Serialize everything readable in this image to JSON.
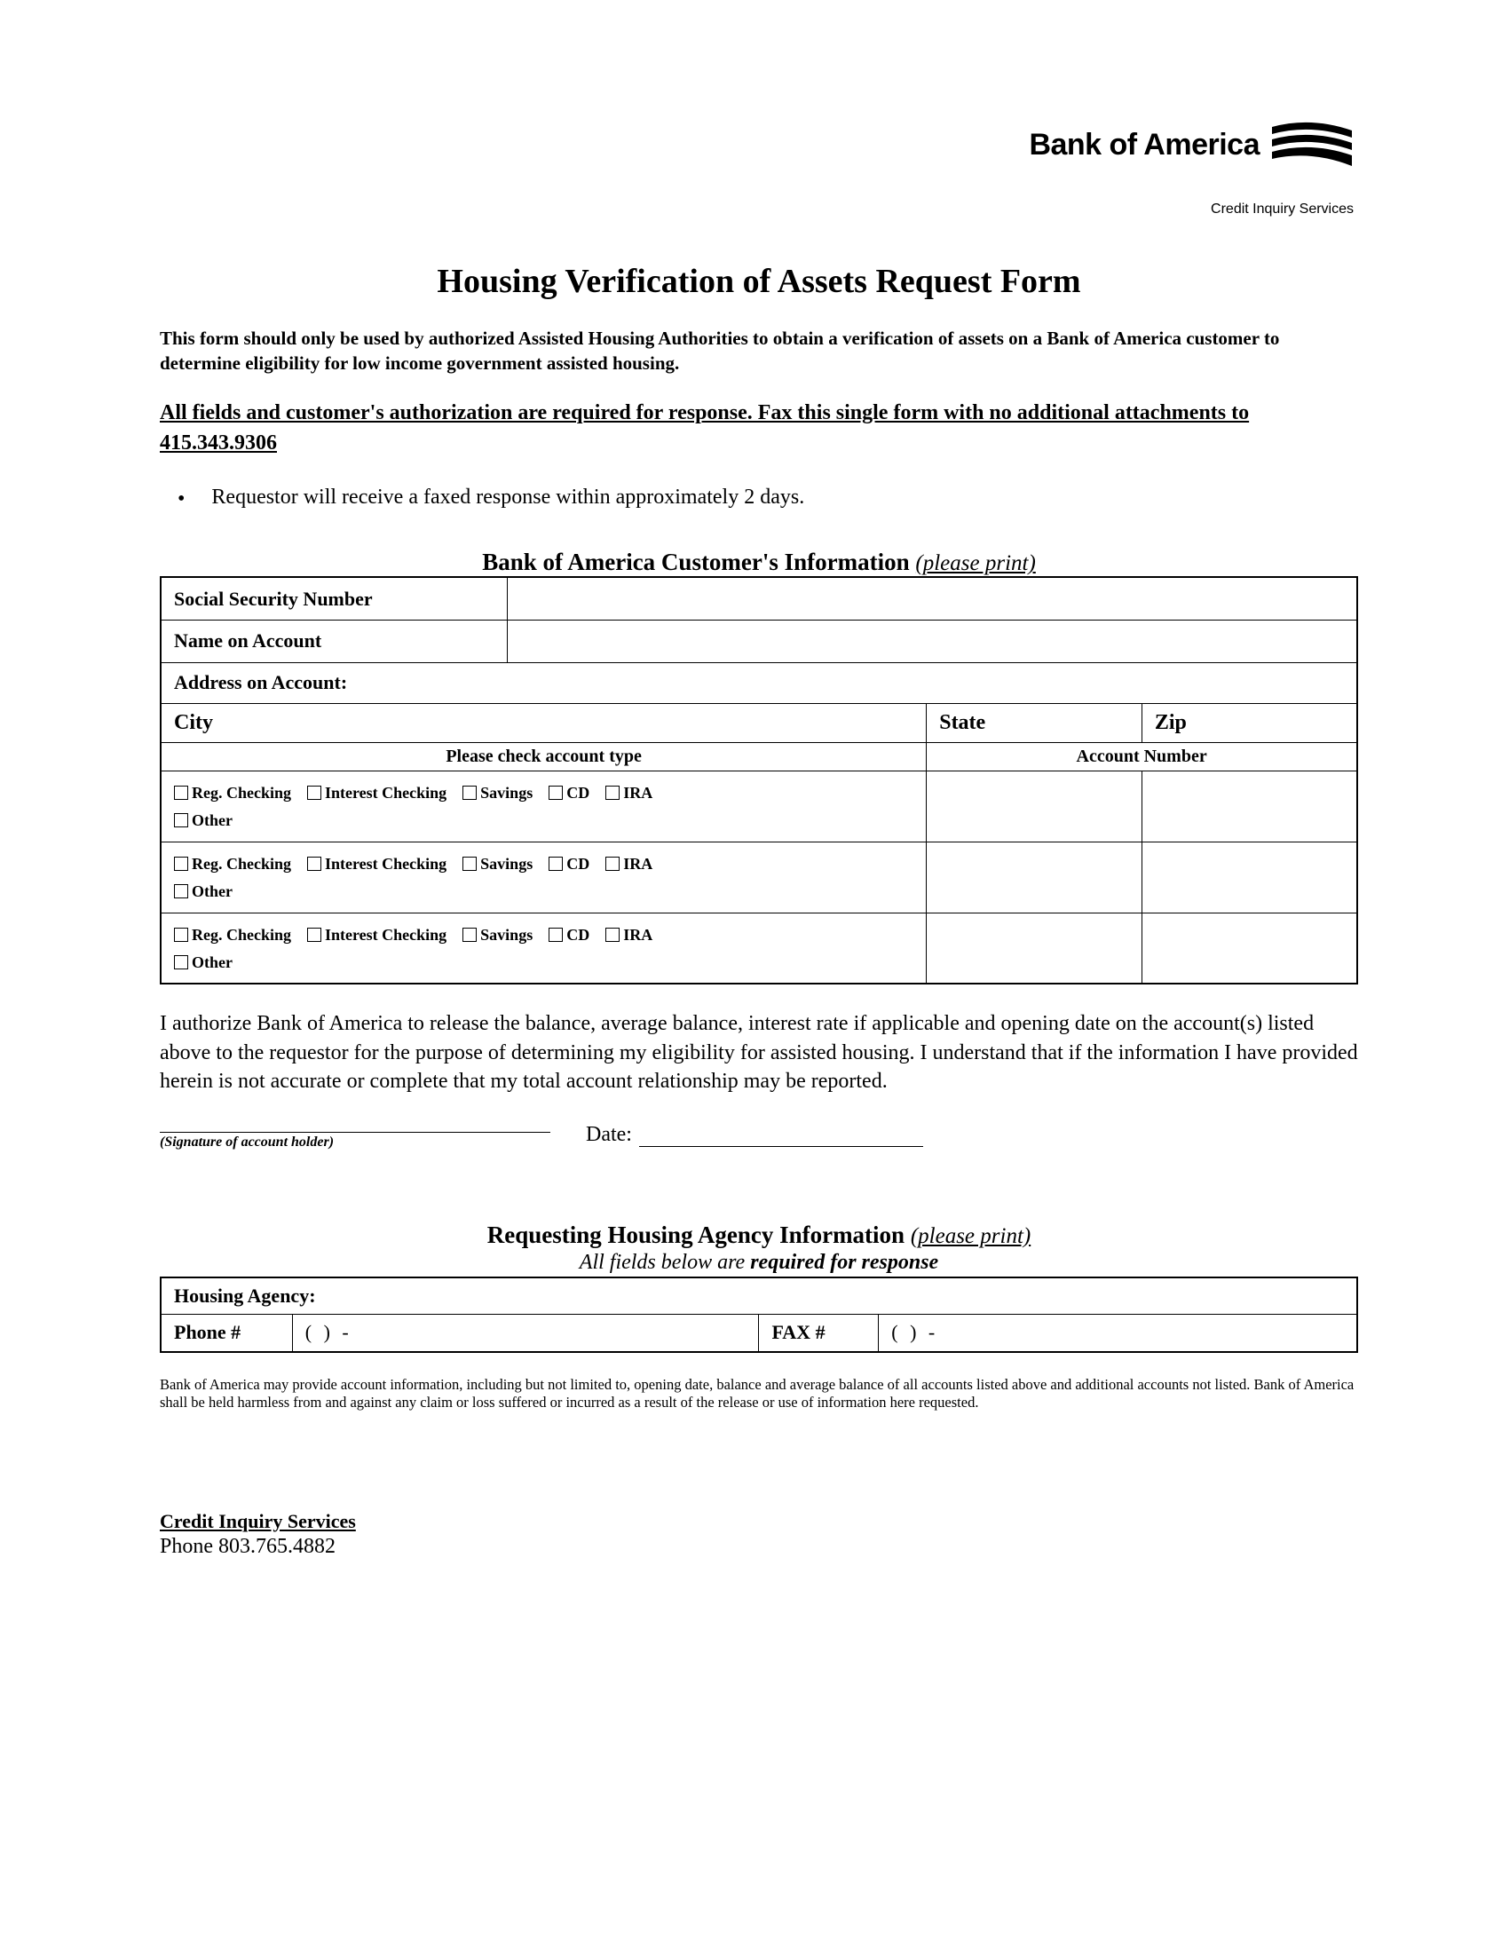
{
  "header": {
    "bank_name": "Bank of America",
    "credit_inquiry": "Credit Inquiry Services"
  },
  "title": "Housing Verification of Assets Request Form",
  "intro": "This form should only be used by authorized Assisted Housing Authorities to obtain a verification of assets on a Bank of America customer to determine eligibility for low income government assisted housing.",
  "fax_instruction": "All fields and customer's authorization are required for response.  Fax this single form with no additional attachments to 415.343.9306",
  "bullet": "Requestor will receive a faxed response within approximately 2 days.",
  "cust_section": {
    "heading": "Bank of America Customer's Information",
    "please_print": "(please print)",
    "ssn_label": "Social Security Number",
    "name_label": "Name on Account",
    "address_label": "Address on Account:",
    "city_label": "City",
    "state_label": "State",
    "zip_label": "Zip",
    "acct_type_header": "Please check account type",
    "acct_number_header": "Account Number",
    "types": {
      "reg": "Reg. Checking",
      "interest": "Interest Checking",
      "savings": "Savings",
      "cd": "CD",
      "ira": "IRA",
      "other": "Other"
    }
  },
  "authorization": "I authorize Bank of America to release the balance, average balance, interest rate if applicable and opening date on the account(s) listed above to the requestor for the purpose of determining my eligibility for assisted housing.  I understand that if the information I have provided herein is not accurate or complete that my total account relationship may be reported.",
  "signature": {
    "caption": "(Signature of account holder)",
    "date_label": "Date:"
  },
  "agency_section": {
    "heading": "Requesting Housing Agency Information",
    "please_print": "(please print)",
    "subtitle_prefix": "All fields below are ",
    "subtitle_bold": "required for response",
    "housing_agency_label": "Housing Agency:",
    "phone_label": "Phone #",
    "fax_label": "FAX #",
    "phone_pattern": "(      )        -"
  },
  "disclaimer": "Bank of America may provide account information, including but not limited to, opening date, balance and average balance of all accounts listed above and additional accounts not listed.  Bank of America shall be held harmless from and against any claim or loss suffered or incurred as a result of the release or use of information here requested.",
  "footer": {
    "title": "Credit Inquiry Services",
    "phone": "Phone 803.765.4882"
  }
}
